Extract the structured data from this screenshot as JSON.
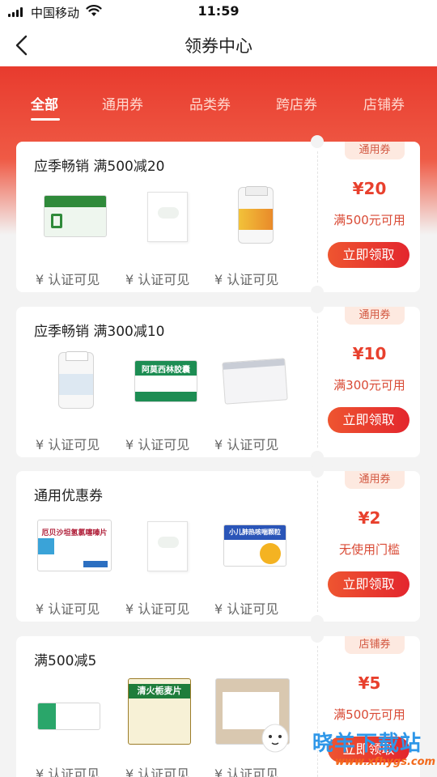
{
  "status_bar": {
    "carrier": "中国移动",
    "time": "11:59"
  },
  "nav": {
    "title": "领券中心"
  },
  "tabs": [
    {
      "label": "全部",
      "active": true
    },
    {
      "label": "通用券",
      "active": false
    },
    {
      "label": "品类券",
      "active": false
    },
    {
      "label": "跨店券",
      "active": false
    },
    {
      "label": "店铺券",
      "active": false
    }
  ],
  "coupons": [
    {
      "title": "应季畅销 满500减20",
      "badge": "通用券",
      "amount": "¥20",
      "condition": "满500元可用",
      "button": "立即领取",
      "products": [
        {
          "price": "¥ 认证可见",
          "image_text": ""
        },
        {
          "price": "¥ 认证可见",
          "image_text": ""
        },
        {
          "price": "¥ 认证可见",
          "image_text": ""
        }
      ]
    },
    {
      "title": "应季畅销 满300减10",
      "badge": "通用券",
      "amount": "¥10",
      "condition": "满300元可用",
      "button": "立即领取",
      "products": [
        {
          "price": "¥ 认证可见",
          "image_text": ""
        },
        {
          "price": "¥ 认证可见",
          "image_text": "阿莫西林胶囊"
        },
        {
          "price": "¥ 认证可见",
          "image_text": ""
        }
      ]
    },
    {
      "title": "通用优惠券",
      "badge": "通用券",
      "amount": "¥2",
      "condition": "无使用门槛",
      "button": "立即领取",
      "products": [
        {
          "price": "¥ 认证可见",
          "image_text": "厄贝沙坦氢氯噻嗪片"
        },
        {
          "price": "¥ 认证可见",
          "image_text": ""
        },
        {
          "price": "¥ 认证可见",
          "image_text": "小儿肺热咳喘颗粒"
        }
      ]
    },
    {
      "title": "满500减5",
      "badge": "店铺券",
      "amount": "¥5",
      "condition": "满500元可用",
      "button": "立即领取",
      "products": [
        {
          "price": "¥ 认证可见",
          "image_text": ""
        },
        {
          "price": "¥ 认证可见",
          "image_text": "清火栀麦片"
        },
        {
          "price": "¥ 认证可见",
          "image_text": ""
        }
      ]
    }
  ],
  "watermark": {
    "text": "晓羊下载站",
    "url": "www.xfhygs.com"
  },
  "colors": {
    "brand_red": "#e83b2e",
    "button_red": "#e3262e",
    "badge_bg": "#fde9e0",
    "background": "#f3f3f3"
  },
  "icons": {
    "back": "chevron-left-icon",
    "wifi": "wifi-icon",
    "signal": "signal-bars-icon"
  }
}
